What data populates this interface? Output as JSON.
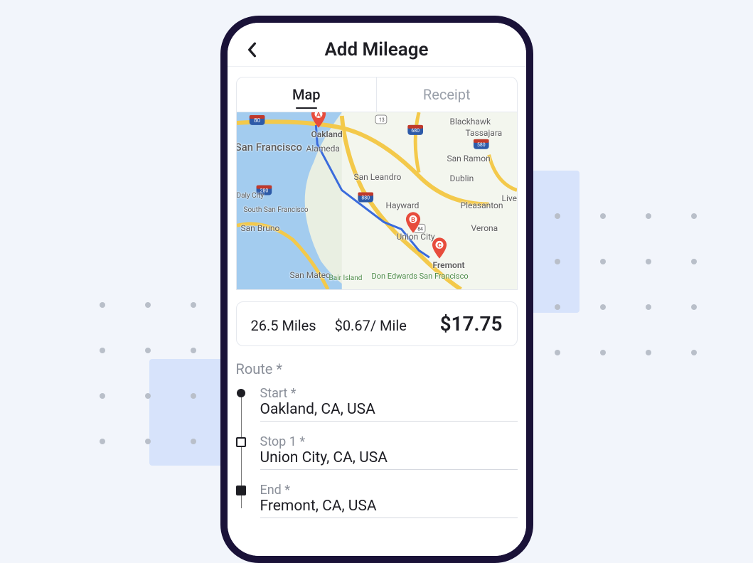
{
  "header": {
    "title": "Add Mileage"
  },
  "tabs": {
    "map": "Map",
    "receipt": "Receipt",
    "active": "map"
  },
  "map": {
    "pins": [
      {
        "letter": "A",
        "label": "Oakland"
      },
      {
        "letter": "B",
        "label": "Union City"
      },
      {
        "letter": "C",
        "label": "Fremont"
      }
    ],
    "labels": [
      "San Francisco",
      "Oakland",
      "Alameda",
      "San Leandro",
      "Hayward",
      "Union City",
      "Fremont",
      "San Mateo",
      "South San Francisco",
      "San Bruno",
      "Daly City",
      "Dublin",
      "Pleasanton",
      "Livermore",
      "San Ramon",
      "Blackhawk",
      "Tassajara",
      "Verona",
      "Don Edwards San Francisco",
      "Bair Island"
    ]
  },
  "summary": {
    "miles": "26.5 Miles",
    "rate": "$0.67/ Mile",
    "total": "$17.75"
  },
  "route": {
    "section_label": "Route *",
    "start_label": "Start *",
    "start_value": "Oakland, CA, USA",
    "stop1_label": "Stop 1 *",
    "stop1_value": "Union City, CA, USA",
    "end_label": "End *",
    "end_value": "Fremont, CA, USA"
  },
  "icons": {
    "back": "chevron-left"
  }
}
